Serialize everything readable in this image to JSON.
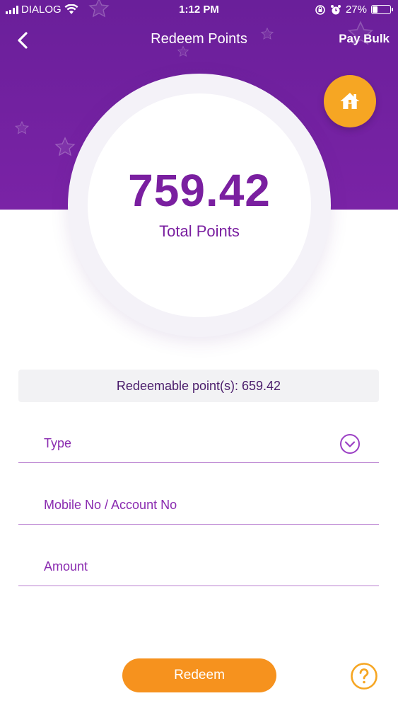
{
  "status_bar": {
    "carrier": "DIALOG",
    "time": "1:12 PM",
    "battery": "27%",
    "battery_level": 0.27
  },
  "nav": {
    "title": "Redeem Points",
    "right_action": "Pay Bulk",
    "back_icon": "chevron-left-icon"
  },
  "summary": {
    "total_points": "759.42",
    "total_label": "Total Points"
  },
  "home_button": {
    "icon": "home-icon",
    "color": "#f6a623"
  },
  "redeemable": {
    "text": "Redeemable point(s): 659.42"
  },
  "form": {
    "type_label": "Type",
    "account_label": "Mobile No / Account No",
    "amount_label": "Amount"
  },
  "actions": {
    "redeem_label": "Redeem",
    "help_icon": "help-icon"
  },
  "colors": {
    "brand_purple": "#7a23a6",
    "accent_orange": "#f6921e",
    "text_purple": "#7a1fa0"
  }
}
